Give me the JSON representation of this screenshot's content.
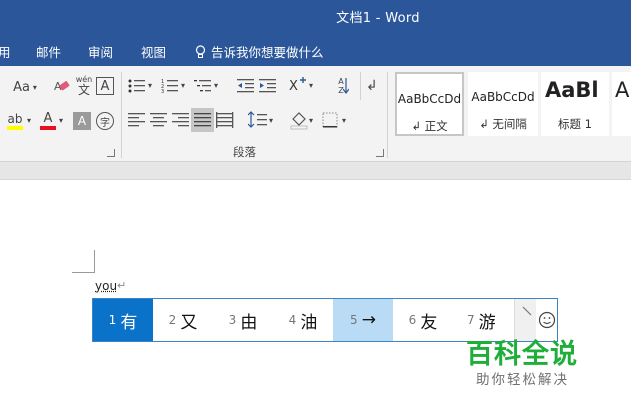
{
  "window": {
    "title": "文档1  -  Word"
  },
  "tabs": [
    {
      "label": "用"
    },
    {
      "label": "邮件"
    },
    {
      "label": "审阅"
    },
    {
      "label": "视图"
    }
  ],
  "tell_me": {
    "label": "告诉我你想要做什么"
  },
  "font_group": {
    "change_case": "Aa",
    "phonetic": "wén",
    "char_border": "A",
    "highlight_letter": "ab",
    "font_color_letter": "A",
    "shading_letter": "A",
    "enclose_char": "字"
  },
  "paragraph_group": {
    "label": "段落",
    "sort_letters": "A Z"
  },
  "styles": [
    {
      "sample": "AaBbCcDd",
      "name": "↲ 正文"
    },
    {
      "sample": "AaBbCcDd",
      "name": "↲ 无间隔"
    },
    {
      "sample": "AaBl",
      "name": "标题 1"
    },
    {
      "sample": "A",
      "name": ""
    }
  ],
  "document": {
    "typed_text": "you",
    "paragraph_mark": "↵"
  },
  "ime": {
    "candidates": [
      {
        "num": "1",
        "char": "有"
      },
      {
        "num": "2",
        "char": "又"
      },
      {
        "num": "3",
        "char": "由"
      },
      {
        "num": "4",
        "char": "油"
      },
      {
        "num": "5",
        "char": "→"
      },
      {
        "num": "6",
        "char": "友"
      },
      {
        "num": "7",
        "char": "游"
      }
    ],
    "selected_index": 0,
    "hover_index": 4
  },
  "watermark": {
    "title": "百科全说",
    "subtitle": "助你轻松解决"
  },
  "colors": {
    "word_blue": "#2b579a",
    "ime_selected": "#0b72c9",
    "ime_hover": "#b9dbf5",
    "highlight_yellow": "#ffff00",
    "font_color_red": "#e81123",
    "watermark_green": "#1fae3a"
  }
}
